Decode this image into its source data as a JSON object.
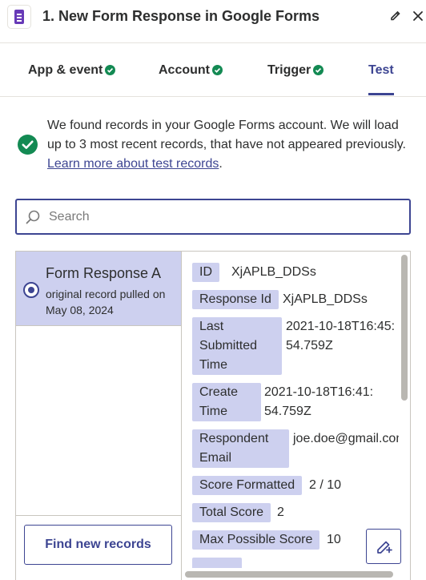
{
  "header": {
    "title": "1. New Form Response in Google Forms",
    "app_icon": "google-forms-icon",
    "edit_icon": "pencil-icon",
    "close_icon": "close-icon"
  },
  "tabs": [
    {
      "label": "App & event",
      "complete": true
    },
    {
      "label": "Account",
      "complete": true
    },
    {
      "label": "Trigger",
      "complete": true
    },
    {
      "label": "Test",
      "active": true
    }
  ],
  "info": {
    "text": "We found records in your Google Forms account. We will load up to 3 most recent records, that have not appeared previously. ",
    "link_text": "Learn more about test records",
    "suffix": "."
  },
  "search": {
    "placeholder": "Search",
    "value": ""
  },
  "records": {
    "items": [
      {
        "title": "Form Response A",
        "subtitle": "original record pulled on May 08, 2024",
        "selected": true
      }
    ],
    "find_button": "Find new records"
  },
  "fields": [
    {
      "key": "ID",
      "value": "XjAPLB_DDSs"
    },
    {
      "key": "Response Id",
      "value": "XjAPLB_DDSs"
    },
    {
      "key": "Last Submitted Time",
      "value": "2021-10-18T16:45:54.759Z"
    },
    {
      "key": "Create Time",
      "value": "2021-10-18T16:41:54.759Z"
    },
    {
      "key": "Respondent Email",
      "value": "joe.doe@gmail.com"
    },
    {
      "key": "Score Formatted",
      "value": "2 / 10"
    },
    {
      "key": "Total Score",
      "value": "2"
    },
    {
      "key": "Max Possible Score",
      "value": "10"
    }
  ],
  "colors": {
    "accent": "#3d4592",
    "highlight": "#cdd0ef",
    "success": "#138a53",
    "forms_purple": "#673ab7"
  }
}
